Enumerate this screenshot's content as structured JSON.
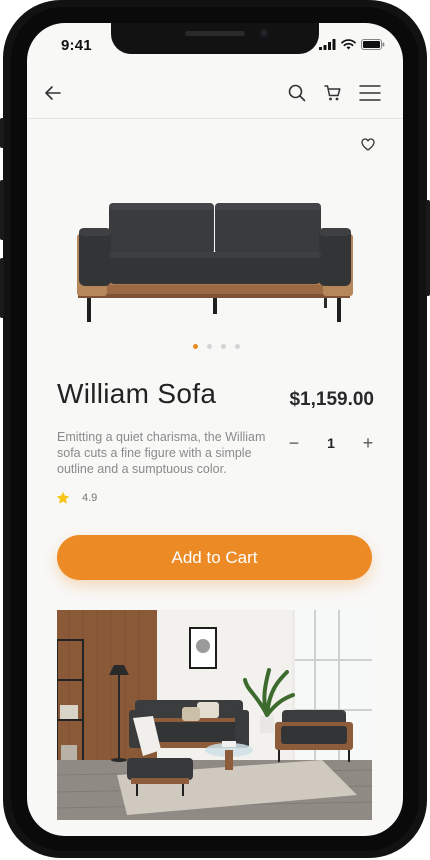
{
  "status_bar": {
    "time": "9:41"
  },
  "nav": {
    "back_icon": "arrow-left-icon",
    "search_icon": "search-icon",
    "cart_icon": "cart-icon",
    "menu_icon": "hamburger-menu-icon"
  },
  "product": {
    "name": "William Sofa",
    "price": "$1,159.00",
    "description": "Emitting a quiet charisma, the William sofa cuts a fine figure with a simple outline and a sumptuous color.",
    "quantity": "1",
    "rating": "4.9",
    "image_count": 4,
    "active_image": 1
  },
  "actions": {
    "decrement": "−",
    "increment": "+",
    "add_to_cart": "Add to Cart"
  },
  "colors": {
    "accent": "#ec8b25",
    "star": "#f5c518",
    "background": "#f8f8f7"
  }
}
